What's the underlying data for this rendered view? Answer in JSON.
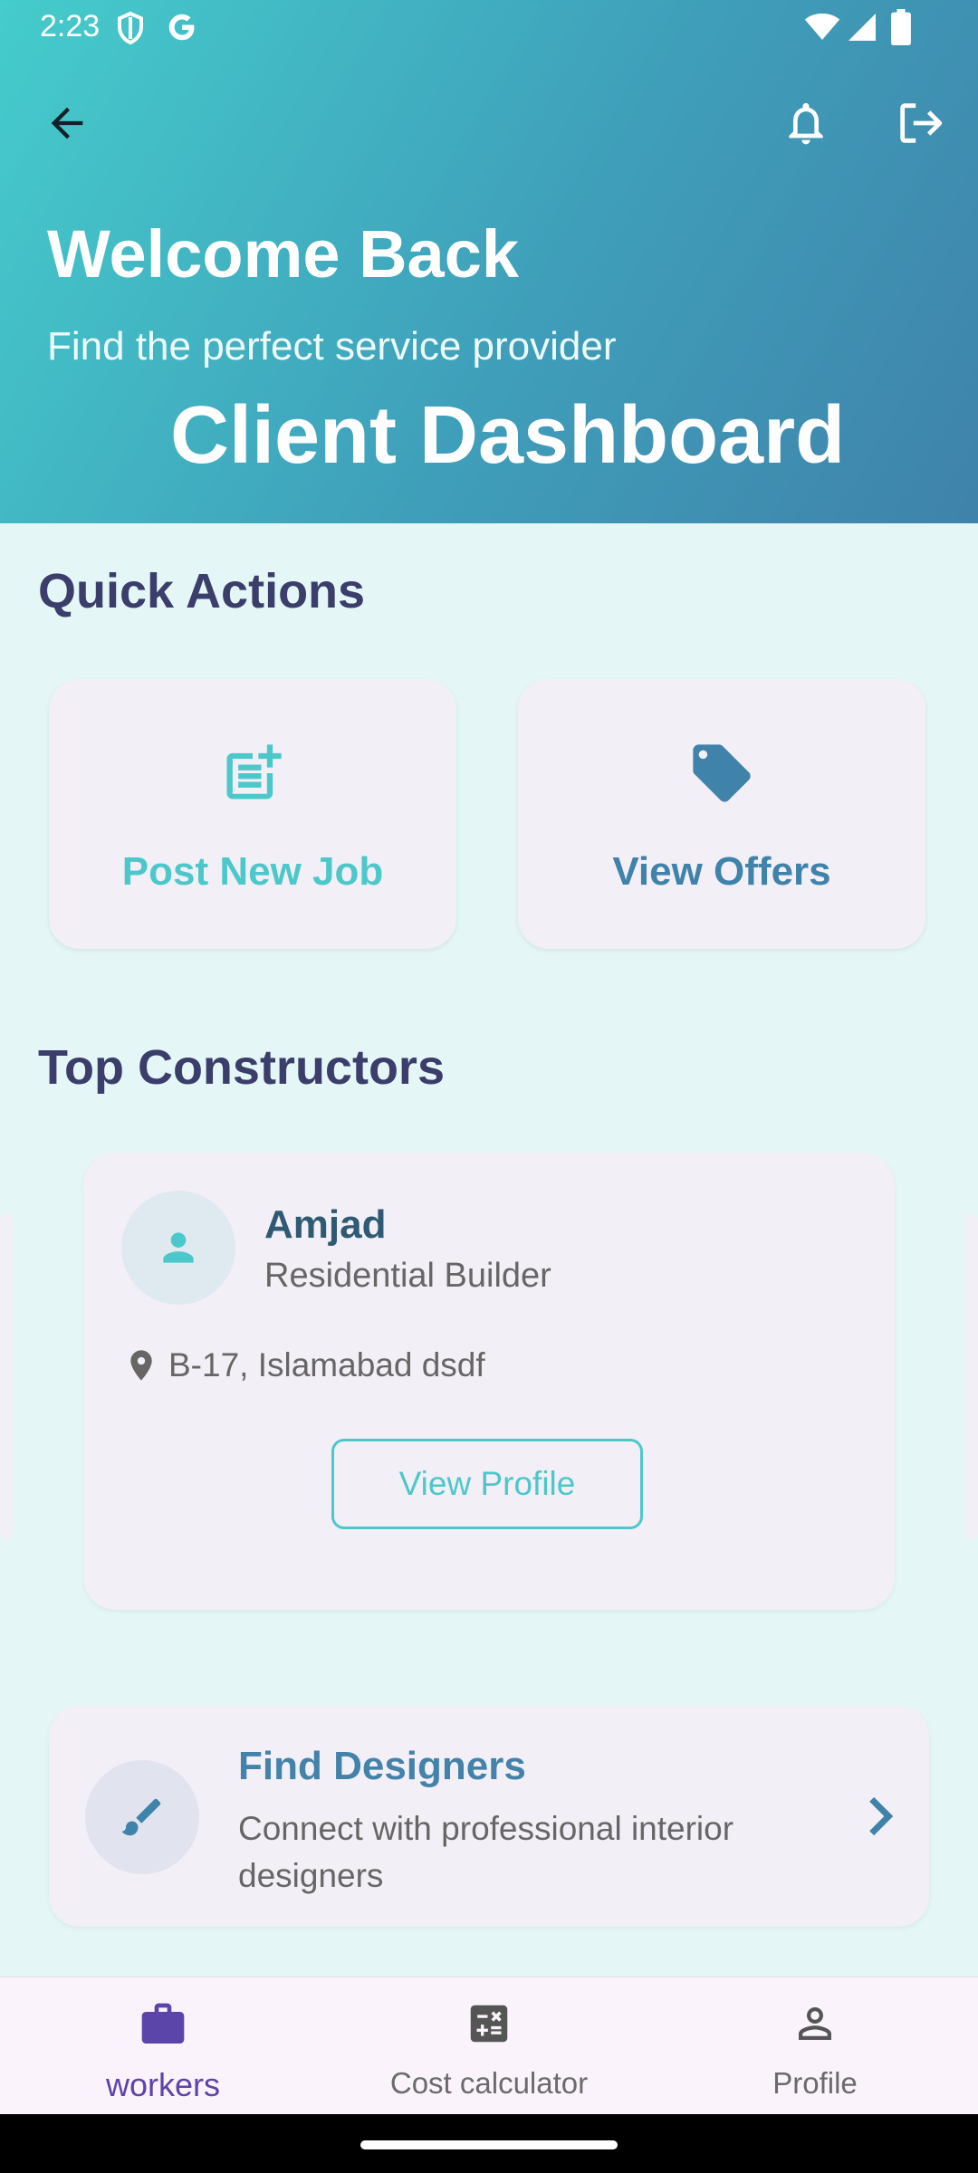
{
  "status_bar": {
    "time": "2:23"
  },
  "header": {
    "title": "Welcome Back",
    "subtitle": "Find the perfect service provider",
    "dashboard_title": "Client Dashboard"
  },
  "quick_actions": {
    "title": "Quick Actions",
    "items": [
      {
        "label": "Post New Job",
        "icon": "post-add-icon",
        "color": "#4cc8cb"
      },
      {
        "label": "View Offers",
        "icon": "tag-icon",
        "color": "#3f82aa"
      }
    ]
  },
  "top_constructors": {
    "title": "Top Constructors",
    "cards": [
      {
        "name": "Amjad",
        "role": "Residential Builder",
        "location": "B-17, Islamabad dsdf",
        "button_label": "View Profile"
      }
    ]
  },
  "find_designers": {
    "title": "Find Designers",
    "description": "Connect with professional interior designers"
  },
  "bottom_nav": {
    "items": [
      {
        "label": "workers",
        "icon": "briefcase-icon",
        "active": true
      },
      {
        "label": "Cost calculator",
        "icon": "calculator-icon",
        "active": false
      },
      {
        "label": "Profile",
        "icon": "person-icon",
        "active": false
      }
    ],
    "active_color": "#5b45a8",
    "inactive_color": "#6b6b6b"
  }
}
